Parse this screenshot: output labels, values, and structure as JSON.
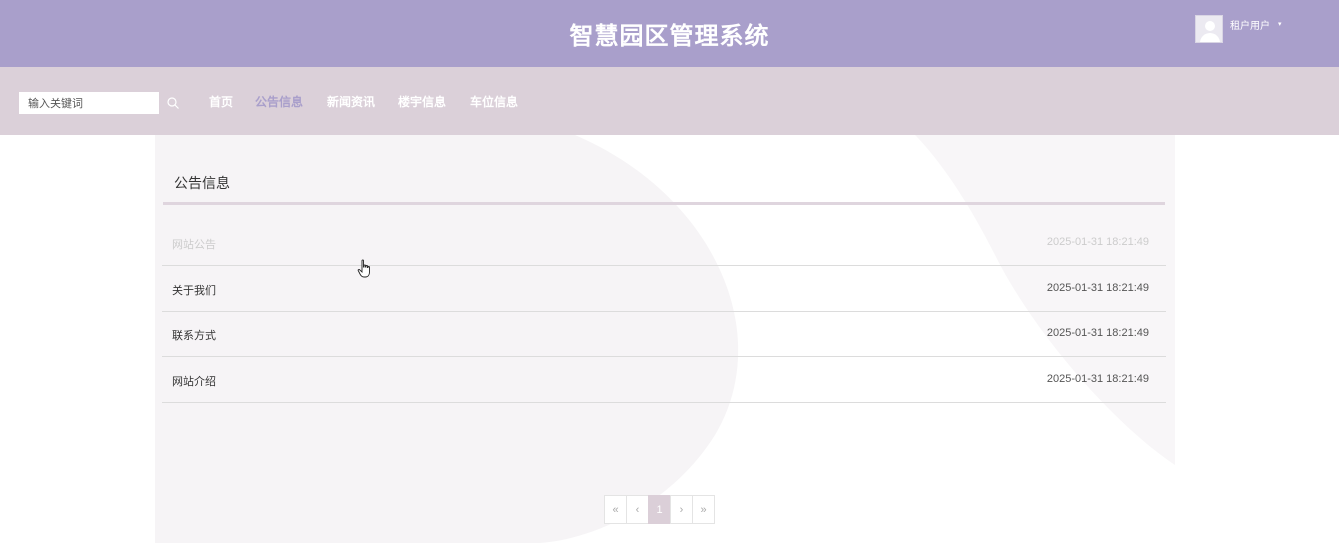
{
  "header": {
    "title": "智慧园区管理系统",
    "user_name": "租户用户",
    "user_caret": "▾"
  },
  "navbar": {
    "search_placeholder": "输入关键词",
    "items": [
      {
        "label": "首页"
      },
      {
        "label": "公告信息",
        "active": true
      },
      {
        "label": "新闻资讯"
      },
      {
        "label": "楼宇信息"
      },
      {
        "label": "车位信息"
      }
    ]
  },
  "main": {
    "section_title": "公告信息",
    "list": [
      {
        "title": "网站公告",
        "date": "2025-01-31 18:21:49"
      },
      {
        "title": "关于我们",
        "date": "2025-01-31 18:21:49"
      },
      {
        "title": "联系方式",
        "date": "2025-01-31 18:21:49"
      },
      {
        "title": "网站介绍",
        "date": "2025-01-31 18:21:49"
      }
    ]
  },
  "pagination": {
    "first": "«",
    "prev": "‹",
    "current": "1",
    "next": "›",
    "last": "»"
  },
  "colors": {
    "header_bg": "#a99fcb",
    "navbar_bg": "#dbd0d9",
    "active_nav": "#a99fcb"
  }
}
